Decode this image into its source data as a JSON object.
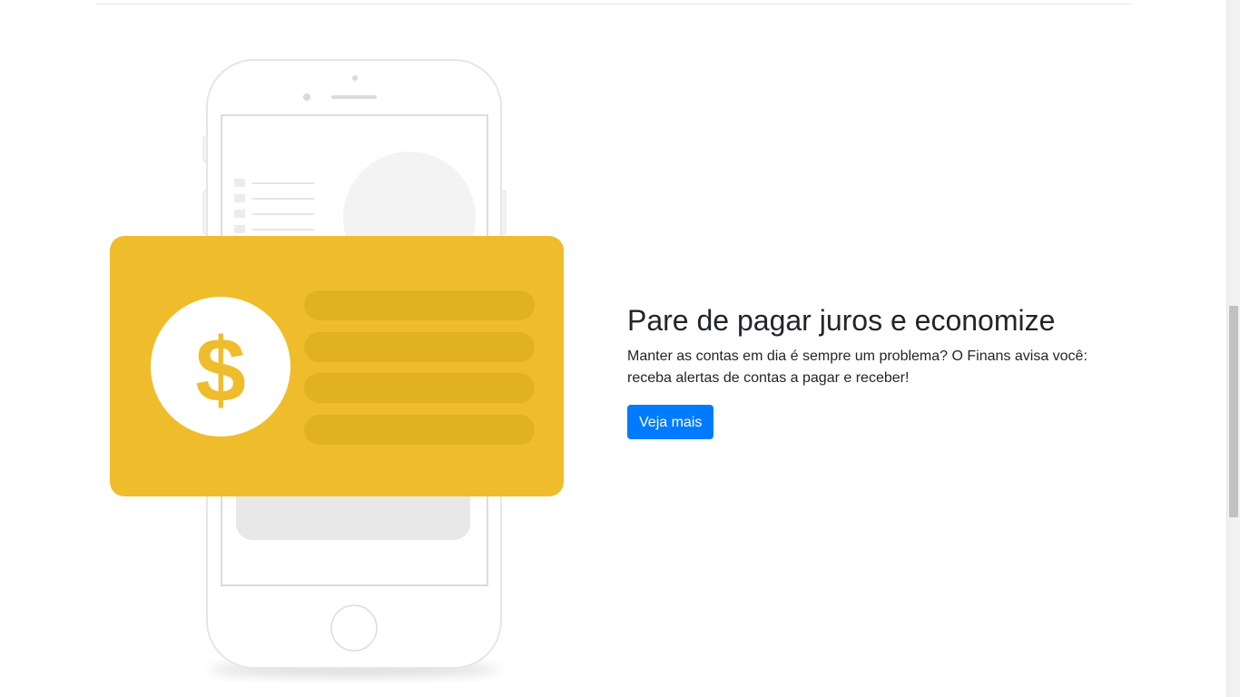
{
  "feature": {
    "title": "Pare de pagar juros e economize",
    "description": "Manter as contas em dia é sempre um problema? O Finans avisa você: receba alertas de contas a pagar e receber!",
    "button_label": "Veja mais"
  },
  "illustration": {
    "currency_symbol": "$",
    "card_color": "#EFBD2C",
    "card_stripe_color": "#E0B220"
  },
  "colors": {
    "accent": "#007bff",
    "text": "#212529"
  }
}
